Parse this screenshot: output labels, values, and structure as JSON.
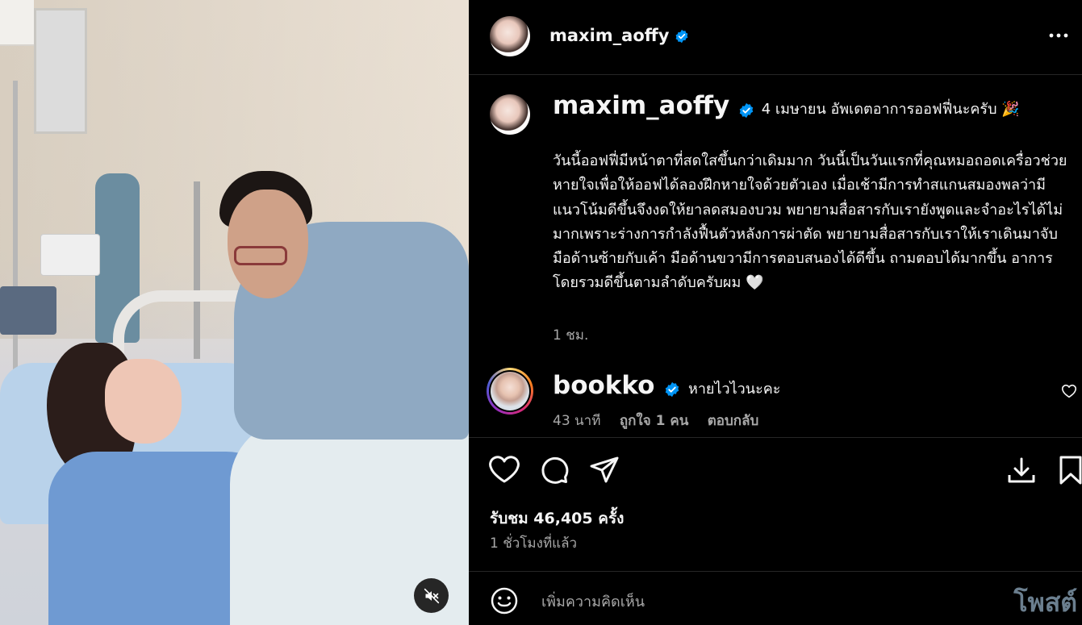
{
  "post": {
    "username": "maxim_aoffy",
    "caption_headline": "4 เมษายน อัพเดตอาการออฟฟี่นะครับ 🎉",
    "caption_body": "วันนี้ออฟฟี่มีหน้าตาที่สดใสขึ้นกว่าเดิมมาก วันนี้เป็นวันแรกที่คุณหมอถอดเครื่อวช่วยหายใจเพื่อให้ออฟได้ลองฝึกหายใจด้วยตัวเอง เมื่อเช้ามีการทำสแกนสมองพลว่ามีแนวโน้มดีขึ้นจึงงดให้ยาลดสมองบวม พยายามสื่อสารกับเรายังพูดและจำอะไรได้ไม่มากเพราะร่างการกำลังฟื้นตัวหลังการผ่าตัด พยายามสื่อสารกับเราให้เราเดินมาจับมือด้านซ้ายกับเค้า มือด้านขวามีการตอบสนองได้ดีขึ้น ถามตอบได้มากขึ้น อาการโดยรวมดีขึ้นตามลำดับครับผม 🤍",
    "caption_time": "1 ชม.",
    "views_label": "รับชม 46,405 ครั้ง",
    "posted_ago": "1 ชั่วโมงที่แล้ว"
  },
  "comment": {
    "username": "bookko",
    "text": "หายไวไวนะคะ",
    "time": "43 นาที",
    "likes": "ถูกใจ 1 คน",
    "reply": "ตอบกลับ"
  },
  "footer": {
    "placeholder": "เพิ่มความคิดเห็น",
    "post_label": "โพสต์"
  },
  "icons": {
    "more": "more-options-icon",
    "like": "heart-icon",
    "comment": "comment-icon",
    "share": "share-icon",
    "download": "download-icon",
    "save": "bookmark-icon",
    "emoji": "emoji-icon",
    "mute": "speaker-muted-icon",
    "verified": "verified-badge-icon"
  },
  "colors": {
    "background": "#000000",
    "verified": "#0095f6",
    "muted_text": "#a8a8a8",
    "post_button": "#6b7f8f"
  }
}
